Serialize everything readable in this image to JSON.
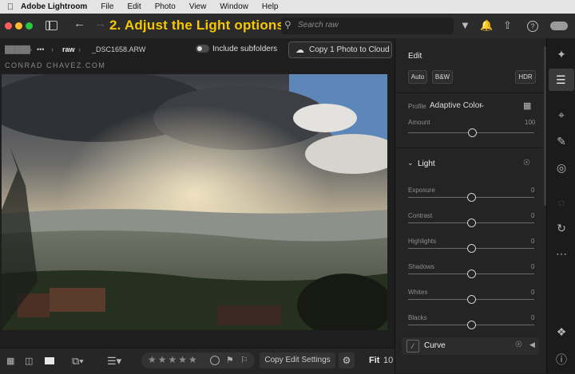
{
  "menubar": {
    "app_name": "Adobe Lightroom",
    "items": [
      "File",
      "Edit",
      "Photo",
      "View",
      "Window",
      "Help"
    ]
  },
  "toolbar": {
    "tip": "2. Adjust the Light options.",
    "search_placeholder": "Search raw"
  },
  "breadcrumb": {
    "hidden": "█████",
    "ellipsis": "•••",
    "folder": "raw",
    "file": "_DSC1658.ARW"
  },
  "subfolders": {
    "label": "Include subfolders"
  },
  "copy_button": {
    "label": "Copy 1 Photo to Cloud"
  },
  "watermark": "CONRAD CHAVEZ.COM",
  "edit": {
    "title": "Edit",
    "auto": "Auto",
    "bw": "B&W",
    "hdr": "HDR",
    "profile_label": "Profile",
    "profile_value": "Adaptive Color",
    "amount_label": "Amount",
    "amount_value": "100",
    "light_title": "Light",
    "sliders": [
      {
        "label": "Exposure",
        "value": "0",
        "level": 0.5
      },
      {
        "label": "Contrast",
        "value": "0",
        "level": 0.5
      },
      {
        "label": "Highlights",
        "value": "0",
        "level": 0.5
      },
      {
        "label": "Shadows",
        "value": "0",
        "level": 0.5
      },
      {
        "label": "Whites",
        "value": "0",
        "level": 0.5
      },
      {
        "label": "Blacks",
        "value": "0",
        "level": 0.5
      }
    ],
    "curve_label": "Curve"
  },
  "bottombar": {
    "copy_edit": "Copy Edit Settings",
    "fit": "Fit",
    "zoom": "10"
  },
  "colors": {
    "tip": "#f6c800",
    "panel": "#242424",
    "toolbar": "#2b2b2b"
  }
}
